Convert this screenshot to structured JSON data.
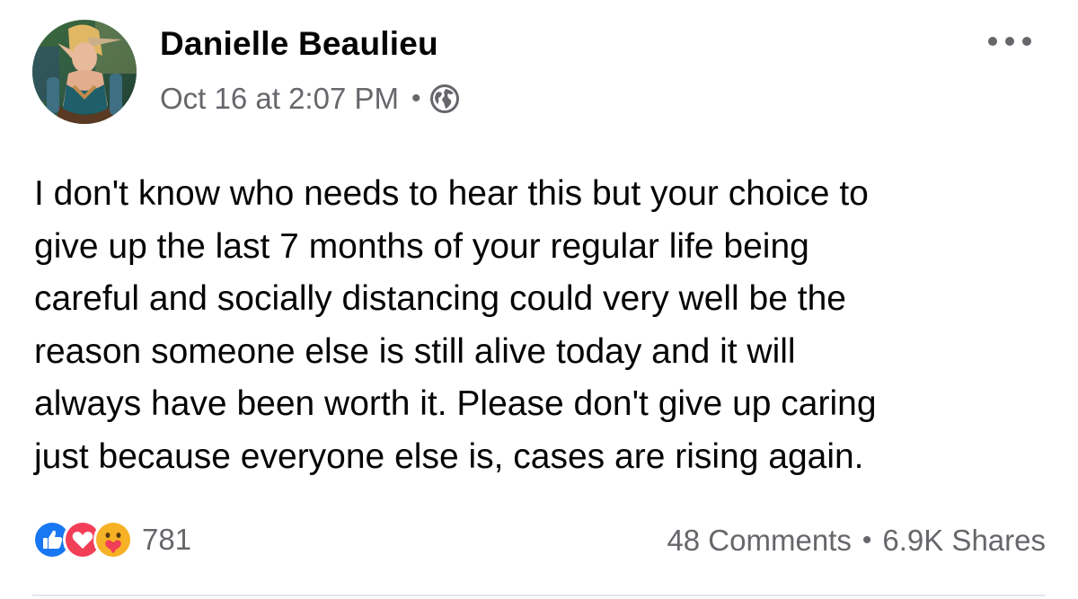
{
  "post": {
    "author_name": "Danielle Beaulieu",
    "timestamp": "Oct 16 at 2:07 PM",
    "meta_separator": "•",
    "privacy_icon": "globe-icon",
    "more_icon": "more-options-icon",
    "text_lines": [
      "I don't know who needs to hear this but your choice to",
      "give up the last 7 months of your regular life being",
      "careful and socially distancing could very well be the",
      "reason someone else is still alive today and it will",
      "always have been worth it. Please don't give up caring",
      "just because everyone else is, cases are rising again."
    ]
  },
  "footer": {
    "reactions": [
      "like-reaction-icon",
      "love-reaction-icon",
      "care-reaction-icon"
    ],
    "reaction_count": "781",
    "comments": "48 Comments",
    "separator": "•",
    "shares": "6.9K Shares"
  },
  "colors": {
    "text_primary": "#050505",
    "text_secondary": "#65676b",
    "like_blue": "#1877f2",
    "love_red": "#f33e58",
    "care_yellow": "#f7b125",
    "divider": "#e4e6eb"
  }
}
